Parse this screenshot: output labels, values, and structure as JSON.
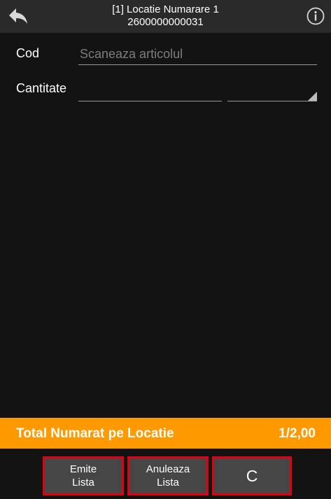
{
  "header": {
    "title_line1": "[1] Locatie Numarare 1",
    "title_line2": "2600000000031",
    "back_icon": "back-arrow-icon",
    "info_icon": "info-icon"
  },
  "form": {
    "cod_label": "Cod",
    "cod_placeholder": "Scaneaza articolul",
    "cantitate_label": "Cantitate",
    "cantitate_value": "",
    "unit_value": ""
  },
  "total": {
    "label": "Total Numarat pe Locatie",
    "value": "1/2,00"
  },
  "buttons": {
    "emite_line1": "Emite",
    "emite_line2": "Lista",
    "anuleaza_line1": "Anuleaza",
    "anuleaza_line2": "Lista",
    "c_label": "C"
  },
  "colors": {
    "accent": "#ff9900",
    "button_border": "#e0000f",
    "background": "#131313",
    "header": "#2a2a2a"
  }
}
